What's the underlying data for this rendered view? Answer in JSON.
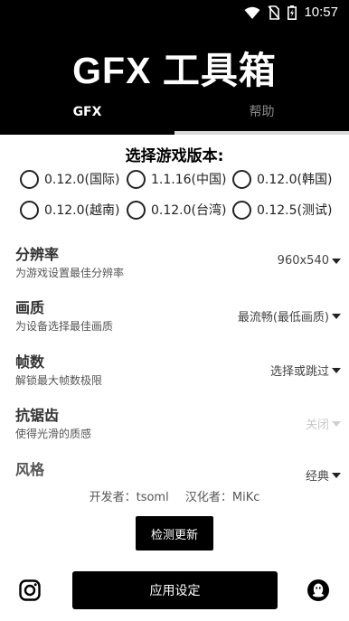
{
  "status_bar": {
    "time": "10:57",
    "icons": [
      "wifi-icon",
      "no-sim-icon",
      "battery-charging-icon"
    ]
  },
  "header": {
    "title": "GFX 工具箱",
    "tabs": [
      {
        "label": "GFX",
        "selected": true
      },
      {
        "label": "帮助",
        "selected": false
      }
    ]
  },
  "version_section": {
    "title": "选择游戏版本:",
    "options": [
      {
        "label": "0.12.0(国际)",
        "selected": false
      },
      {
        "label": "1.1.16(中国)",
        "selected": false
      },
      {
        "label": "0.12.0(韩国)",
        "selected": false
      },
      {
        "label": "0.12.0(越南)",
        "selected": false
      },
      {
        "label": "0.12.0(台湾)",
        "selected": false
      },
      {
        "label": "0.12.5(测试)",
        "selected": false
      }
    ]
  },
  "settings": [
    {
      "title": "分辨率",
      "description": "为游戏设置最佳分辨率",
      "value": "960x540",
      "enabled": true
    },
    {
      "title": "画质",
      "description": "为设备选择最佳画质",
      "value": "最流畅(最低画质)",
      "enabled": true
    },
    {
      "title": "帧数",
      "description": "解锁最大帧数极限",
      "value": "选择或跳过",
      "enabled": true
    },
    {
      "title": "抗锯齿",
      "description": "使得光滑的质感",
      "value": "关闭",
      "enabled": false
    },
    {
      "title": "风格",
      "description": "",
      "value": "经典",
      "enabled": true
    }
  ],
  "credits": {
    "developer": "开发者：tsoml",
    "translator": "汉化者：MiKc"
  },
  "buttons": {
    "check_update": "检测更新",
    "apply": "应用设定"
  },
  "footer_icons": [
    "instagram-icon",
    "qq-icon"
  ]
}
